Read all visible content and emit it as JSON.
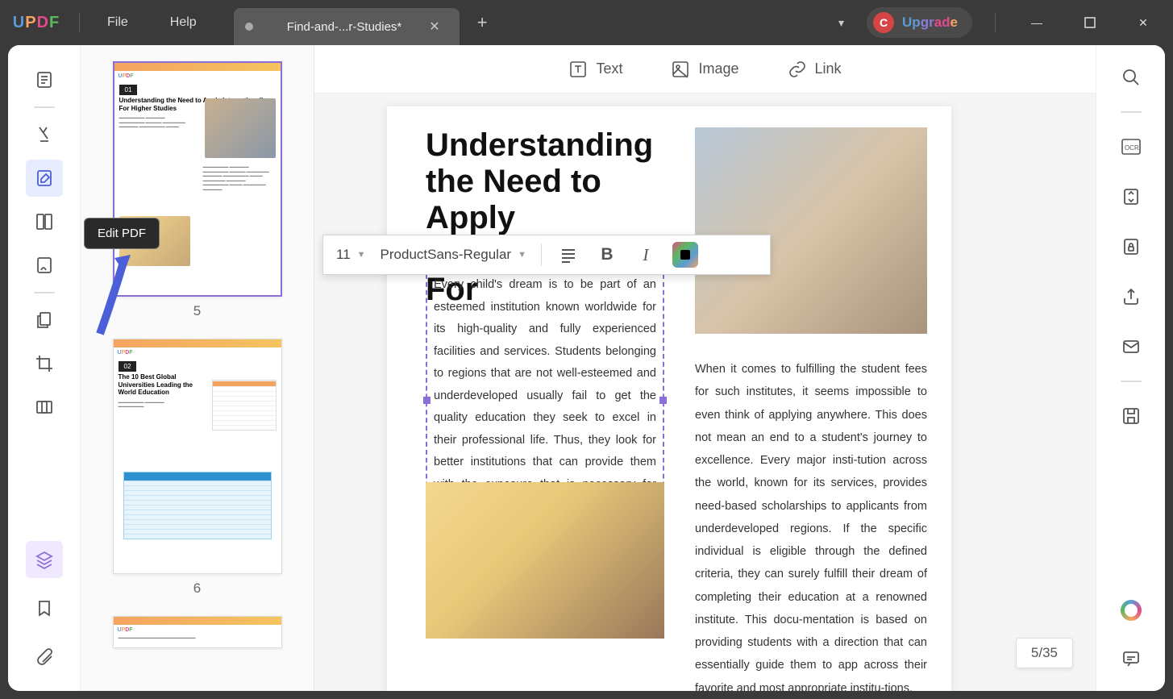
{
  "titlebar": {
    "menu_file": "File",
    "menu_help": "Help",
    "tab_title": "Find-and-...r-Studies*",
    "upgrade": "Upgrade",
    "avatar": "C"
  },
  "left_tooltip": "Edit PDF",
  "edit_toolbar": {
    "text": "Text",
    "image": "Image",
    "link": "Link"
  },
  "format_bar": {
    "size": "11",
    "font": "ProductSans-Regular"
  },
  "thumbnails": {
    "p5": {
      "num": "5",
      "badge": "01",
      "title": "Understanding the Need to Apply Internationally For Higher Studies"
    },
    "p6": {
      "num": "6",
      "badge": "02",
      "title": "The 10 Best Global Universities Leading the World Education"
    }
  },
  "document": {
    "title": "Understanding the Need to Apply Internationally For",
    "selected_text": "Every child's dream is to be part of an esteemed institution known worldwide for its high-quality and fully experienced facilities and services. Students belonging to regions that are not well-esteemed and underdeveloped usually fail to get the quality education they seek to excel in their professional life. Thus, they look for better institutions that can provide them with the exposure that is necessary for them to excel in the professional field.",
    "col2": "When it comes to fulfilling the student fees for such institutes, it seems impossible to even think of applying anywhere. This does not mean an end to a student's journey to excellence. Every major insti-tution across the world, known for its services, provides need-based scholarships to applicants from underdeveloped regions. If the specific individual is eligible through the defined criteria, they can surely fulfill their dream of completing their education at a renowned institute. This docu-mentation is based on providing students with a direction that can essentially guide them to app across their favorite and most appropriate institu-tions."
  },
  "page_indicator": "5/35"
}
